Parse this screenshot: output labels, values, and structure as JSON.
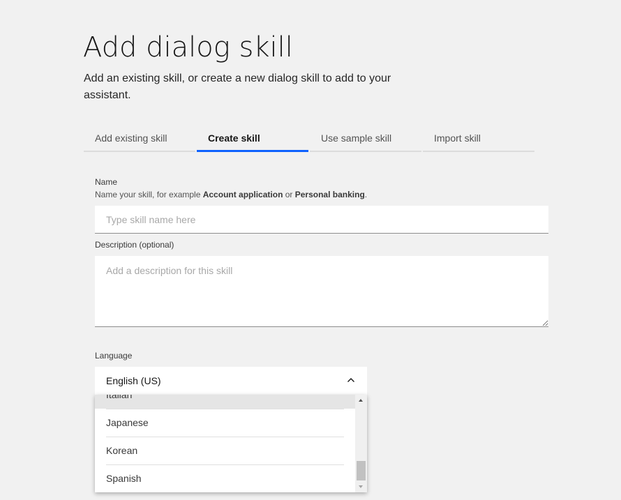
{
  "page": {
    "title": "Add dialog skill",
    "subtitle": "Add an existing skill, or create a new dialog skill to add to your assistant."
  },
  "tabs": [
    {
      "label": "Add existing skill",
      "active": false
    },
    {
      "label": "Create skill",
      "active": true
    },
    {
      "label": "Use sample skill",
      "active": false
    },
    {
      "label": "Import skill",
      "active": false
    }
  ],
  "form": {
    "name": {
      "label": "Name",
      "helper_prefix": "Name your skill, for example ",
      "helper_example1": "Account application",
      "helper_or": " or ",
      "helper_example2": "Personal banking",
      "helper_suffix": ".",
      "placeholder": "Type skill name here",
      "value": ""
    },
    "description": {
      "label": "Description (optional)",
      "placeholder": "Add a description for this skill",
      "value": ""
    },
    "language": {
      "label": "Language",
      "selected": "English (US)",
      "options": [
        "Italian",
        "Japanese",
        "Korean",
        "Spanish"
      ],
      "highlighted_index": 0
    }
  },
  "colors": {
    "accent": "#0f62fe",
    "background": "#f1f1f1",
    "field_background": "#ffffff"
  },
  "icons": {
    "select_chevron": "chevron-up-icon",
    "scroll_up": "scroll-up-arrow-icon",
    "scroll_down": "scroll-down-arrow-icon"
  }
}
